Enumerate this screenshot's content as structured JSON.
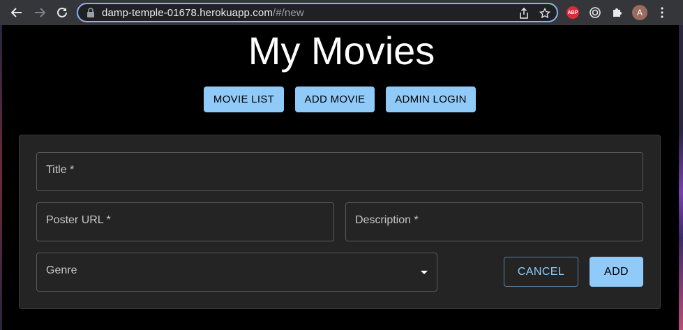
{
  "browser": {
    "url_host": "damp-temple-01678.herokuapp.com",
    "url_path": "/#/new",
    "abp_label": "ABP",
    "avatar_initial": "A"
  },
  "page": {
    "title": "My Movies"
  },
  "nav": {
    "movie_list": "MOVIE LIST",
    "add_movie": "ADD MOVIE",
    "admin_login": "ADMIN LOGIN"
  },
  "form": {
    "title_label": "Title *",
    "poster_label": "Poster URL *",
    "description_label": "Description *",
    "genre_label": "Genre",
    "cancel_label": "CANCEL",
    "add_label": "ADD"
  },
  "colors": {
    "accent": "#90caf9",
    "panel": "#242424",
    "background": "#000000"
  }
}
